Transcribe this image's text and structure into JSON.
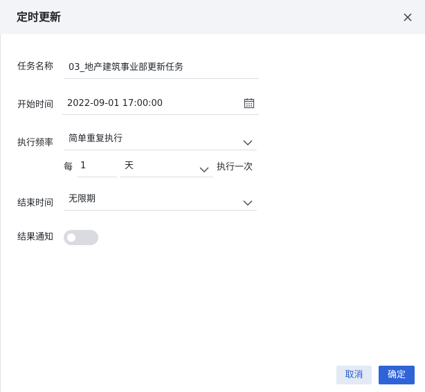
{
  "dialog": {
    "title": "定时更新",
    "close_icon": "close-icon"
  },
  "form": {
    "task_name": {
      "label": "任务名称",
      "value": "03_地产建筑事业部更新任务"
    },
    "start_time": {
      "label": "开始时间",
      "value": "2022-09-01 17:00:00",
      "icon": "calendar-icon"
    },
    "frequency": {
      "label": "执行频率",
      "value": "简单重复执行",
      "icon": "chevron-down-icon"
    },
    "repeat": {
      "prefix": "每",
      "count": "1",
      "unit": "天",
      "suffix": "执行一次",
      "icon": "chevron-down-icon"
    },
    "end_time": {
      "label": "结束时间",
      "value": "无限期",
      "icon": "chevron-down-icon"
    },
    "notify": {
      "label": "结果通知",
      "enabled": false
    }
  },
  "footer": {
    "cancel_label": "取消",
    "ok_label": "确定"
  },
  "colors": {
    "header_bg": "#f2f4f7",
    "primary": "#2f63d8",
    "cancel_bg": "#e3eaf6",
    "toggle_off": "#d9dbe0"
  }
}
